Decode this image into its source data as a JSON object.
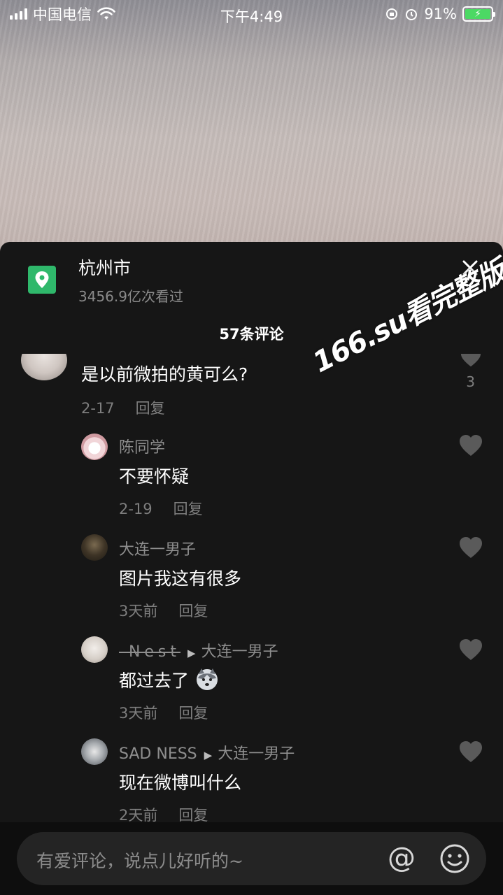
{
  "status_bar": {
    "carrier": "中国电信",
    "time": "下午4:49",
    "battery": "91%"
  },
  "location": {
    "title": "杭州市",
    "views": "3456.9亿次看过"
  },
  "comments_header": "57条评论",
  "watermark": "166.su看完整版",
  "comments": [
    {
      "name": "",
      "text": "是以前微拍的黄可么?",
      "date": "2-17",
      "reply": "回复",
      "likes": "3"
    },
    {
      "name": "陈同学",
      "text": "不要怀疑",
      "date": "2-19",
      "reply": "回复"
    },
    {
      "name": "大连一男子",
      "text": "图片我这有很多",
      "date": "3天前",
      "reply": "回复"
    },
    {
      "name": "-Nest",
      "reply_to": "大连一男子",
      "text": "都过去了",
      "date": "3天前",
      "reply": "回复"
    },
    {
      "name": "SAD NESS",
      "reply_to": "大连一男子",
      "text": "现在微博叫什么",
      "date": "2天前",
      "reply": "回复"
    }
  ],
  "input": {
    "placeholder": "有爱评论，说点儿好听的~",
    "at_symbol": "@"
  },
  "colors": {
    "background": "#161616",
    "accent_green": "#2fb86b",
    "muted_text": "#8e8e8e"
  }
}
